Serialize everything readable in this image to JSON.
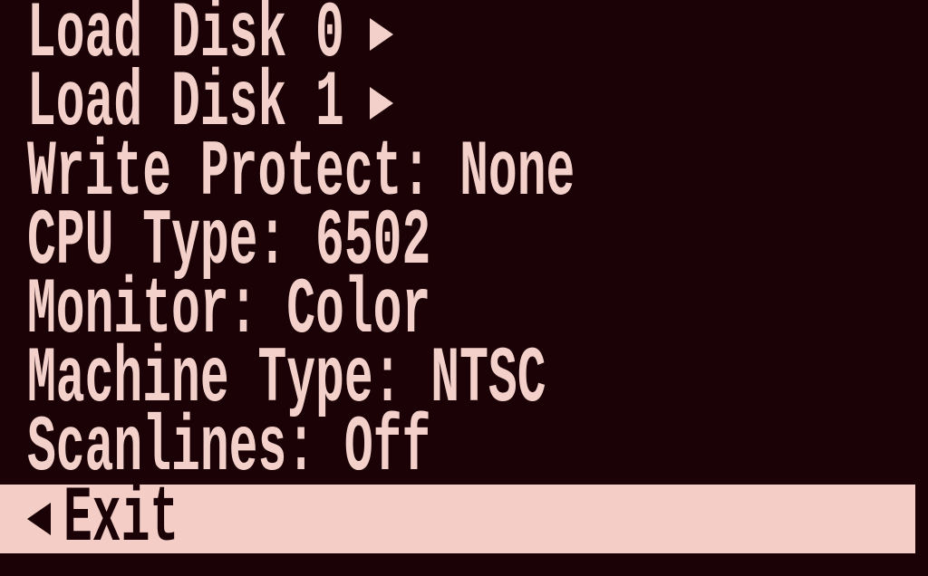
{
  "colors": {
    "background": "#1a0206",
    "text": "#f3d0c9",
    "highlight": "#f3cdc6"
  },
  "menu": {
    "items": [
      {
        "label": "Load Disk 0",
        "icon": "triangle-right-icon"
      },
      {
        "label": "Load Disk 1",
        "icon": "triangle-right-icon"
      },
      {
        "label": "Write Protect: None"
      },
      {
        "label": "CPU Type: 6502"
      },
      {
        "label": "Monitor: Color"
      },
      {
        "label": "Machine Type: NTSC"
      },
      {
        "label": "Scanlines: Off"
      }
    ],
    "exit": {
      "label": "Exit",
      "icon": "triangle-left-icon",
      "selected": true
    }
  }
}
